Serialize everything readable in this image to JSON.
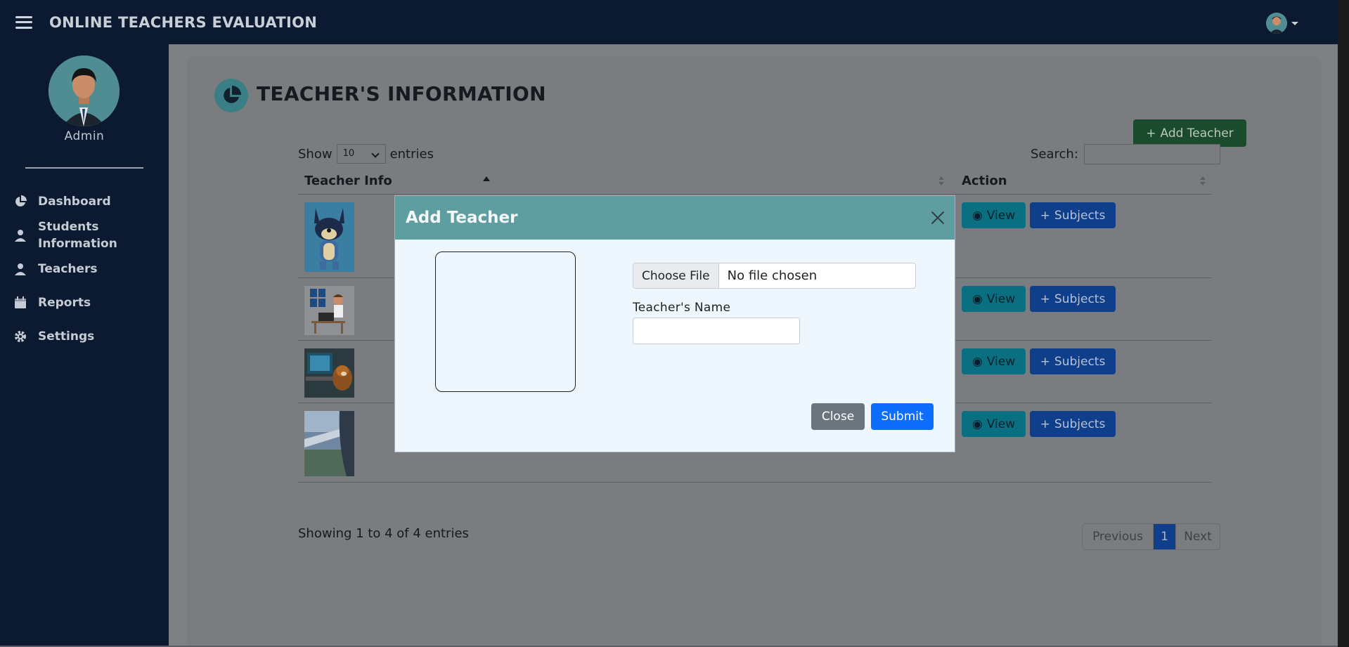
{
  "app": {
    "title": "ONLINE TEACHERS EVALUATION"
  },
  "sidebar": {
    "admin_name": "Admin",
    "items": [
      {
        "label": "Dashboard",
        "icon": "pie-chart-icon"
      },
      {
        "label": "Students Information",
        "icon": "user-icon"
      },
      {
        "label": "Teachers",
        "icon": "user-icon"
      },
      {
        "label": "Reports",
        "icon": "calendar-icon"
      },
      {
        "label": "Settings",
        "icon": "gear-icon"
      }
    ]
  },
  "main": {
    "title": "TEACHER'S INFORMATION",
    "add_button": "Add Teacher",
    "show_label": "Show",
    "entries_value": "10",
    "entries_label": "entries",
    "search_label": "Search:",
    "columns": {
      "teacher_info": "Teacher Info",
      "action": "Action"
    },
    "rows": [
      {
        "thumb": "cartoon-dog-photo"
      },
      {
        "thumb": "desk-worker-illustration"
      },
      {
        "thumb": "dog-at-laptop-photo"
      },
      {
        "thumb": "airplane-window-photo"
      }
    ],
    "view_label": "View",
    "subjects_label": "Subjects",
    "showing": "Showing 1 to 4 of 4 entries",
    "pagination": {
      "previous": "Previous",
      "current": "1",
      "next": "Next"
    }
  },
  "modal": {
    "title": "Add Teacher",
    "choose_file": "Choose File",
    "file_status": "No file chosen",
    "name_label": "Teacher's Name",
    "close_label": "Close",
    "submit_label": "Submit"
  },
  "colors": {
    "topbar": "#0b1a30",
    "modal_header": "#5f9ea0",
    "submit": "#0d6efd",
    "close": "#6c757d"
  }
}
